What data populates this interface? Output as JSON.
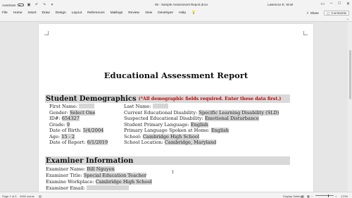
{
  "titlebar": {
    "autosave_label": "AutoSave",
    "autosave_state": "Off",
    "doc_title": "05 - Sample Assessment Report.docx",
    "user": "Lawrence E. Sinel"
  },
  "menu": {
    "tabs": [
      "File",
      "Home",
      "Insert",
      "Draw",
      "Design",
      "Layout",
      "References",
      "Mailings",
      "Review",
      "View",
      "Developer",
      "Help"
    ],
    "search_icon": "lightbulb-icon",
    "share_label": "Share",
    "comments_label": "Comments"
  },
  "document": {
    "title": "Educational Assessment Report",
    "demographics": {
      "heading": "Student Demographics",
      "required_note": "(*All demographic fields required. Enter these data first.)",
      "left": [
        {
          "label": "First Name:",
          "value": ""
        },
        {
          "label": "Gender:",
          "value": "Select One"
        },
        {
          "label": "ID#:",
          "value": "654327"
        },
        {
          "label": "Grade:",
          "value": "9"
        },
        {
          "label": "Date of Birth:",
          "value": "5/4/2004"
        },
        {
          "label": "Age:",
          "value": "15 - 2"
        },
        {
          "label": "Date of Report:",
          "value": "6/1/2019"
        }
      ],
      "right": [
        {
          "label": "Last Name:",
          "value": ""
        },
        {
          "label": "Current Educational Disability:",
          "value": "Specific Learning Disability (SLD)"
        },
        {
          "label": "Suspected Educational Disability:",
          "value": "Emotional Disturbance"
        },
        {
          "label": "Student Primary Language:",
          "value": "English"
        },
        {
          "label": "Primary Language Spoken at Home:",
          "value": "English"
        },
        {
          "label": "School:",
          "value": "Cambridge High School"
        },
        {
          "label": "School Location:",
          "value": "Cambridge, Maryland"
        }
      ]
    },
    "examiner": {
      "heading": "Examiner Information",
      "rows": [
        {
          "label": "Examiner Name:",
          "value": "Bill Nguyen"
        },
        {
          "label": "Examiner Title:",
          "value": "Special Education Teacher"
        },
        {
          "label": "Examine Workplace:",
          "value": "Cambridge High School"
        },
        {
          "label": "Examiner Email:",
          "value": ""
        }
      ]
    }
  },
  "statusbar": {
    "page": "Page 1 of 5",
    "words": "4050 words",
    "display_settings": "Display Settings",
    "zoom": "170%"
  }
}
